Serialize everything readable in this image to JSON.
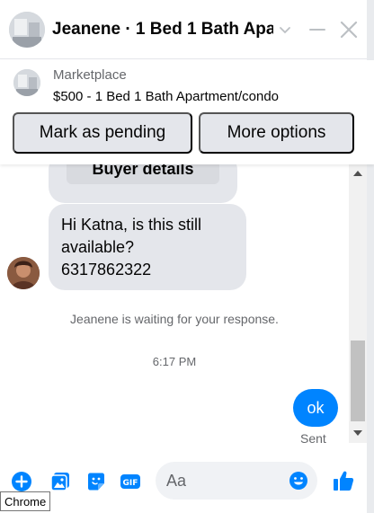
{
  "header": {
    "title": "Jeanene · 1 Bed 1 Bath Apa…",
    "avatar_icon": "house-photo-avatar",
    "icons": [
      "chevron-down-icon",
      "minimize-icon",
      "close-icon"
    ]
  },
  "banner": {
    "label": "Marketplace",
    "listing": "$500 - 1 Bed 1 Bath Apartment/condo",
    "mark_pending_label": "Mark as pending",
    "more_options_label": "More options"
  },
  "messages": {
    "buyer_details_label": "Buyer details",
    "received_lines": [
      "Hi Katna, is this still",
      "available?",
      "6317862322"
    ],
    "waiting_notice": "Jeanene is waiting for your response.",
    "timestamp": "6:17 PM",
    "sent_text": "ok",
    "sent_status": "Sent"
  },
  "composer": {
    "placeholder": "Aa",
    "icons": [
      "plus-circle-icon",
      "photo-icon",
      "sticker-icon",
      "gif-icon",
      "emoji-icon",
      "thumbs-up-icon"
    ]
  },
  "tooltip": {
    "text": "Chrome"
  },
  "colors": {
    "accent": "#0084ff",
    "icon_blue": "#0084ff",
    "bubble_gray": "#e4e6eb",
    "secondary_text": "#65676b"
  }
}
